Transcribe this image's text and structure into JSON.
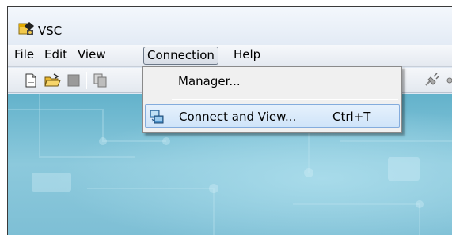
{
  "window": {
    "title": "VSC"
  },
  "menubar": {
    "items": [
      {
        "label": "File"
      },
      {
        "label": "Edit"
      },
      {
        "label": "View"
      },
      {
        "label": "Connection"
      },
      {
        "label": "Help"
      }
    ]
  },
  "connection_menu": {
    "items": [
      {
        "label": "Manager...",
        "shortcut": ""
      },
      {
        "label": "Connect and View...",
        "shortcut": "Ctrl+T"
      }
    ]
  },
  "toolbar": {
    "icons": [
      "new-document-icon",
      "open-folder-icon",
      "stop-icon",
      "copy-icon",
      "connect-plug-icon",
      "network-icon"
    ]
  },
  "colors": {
    "menu_highlight": "#cfe4f9",
    "client_background": "#7ebfd5"
  }
}
